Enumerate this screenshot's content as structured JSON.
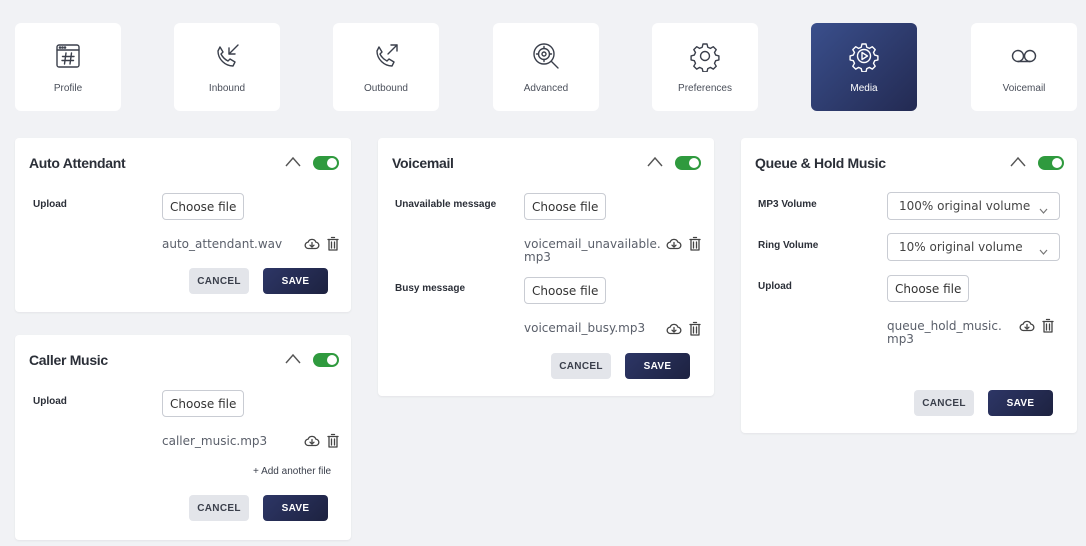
{
  "tabs": [
    {
      "label": "Profile",
      "icon": "hash-window-icon"
    },
    {
      "label": "Inbound",
      "icon": "phone-incoming-icon"
    },
    {
      "label": "Outbound",
      "icon": "phone-outgoing-icon"
    },
    {
      "label": "Advanced",
      "icon": "gear-search-icon"
    },
    {
      "label": "Preferences",
      "icon": "gear-icon"
    },
    {
      "label": "Media",
      "icon": "gear-play-icon"
    },
    {
      "label": "Voicemail",
      "icon": "voicemail-icon"
    }
  ],
  "active_tab": "Media",
  "colors": {
    "accent": "#2d3666",
    "toggle_on": "#2f9a3e"
  },
  "auto_attendant": {
    "title": "Auto Attendant",
    "upload_label": "Upload",
    "choose_file": "Choose file",
    "file_name": "auto_attendant.wav",
    "cancel": "CANCEL",
    "save": "SAVE"
  },
  "caller_music": {
    "title": "Caller Music",
    "upload_label": "Upload",
    "choose_file": "Choose file",
    "file_name": "caller_music.mp3",
    "add_another": "+ Add another file",
    "cancel": "CANCEL",
    "save": "SAVE"
  },
  "voicemail": {
    "title": "Voicemail",
    "unavailable_label": "Unavailable message",
    "choose_file_1": "Choose file",
    "unavailable_file_line1": "voicemail_unavailable.",
    "unavailable_file_line2": "mp3",
    "busy_label": "Busy message",
    "choose_file_2": "Choose file",
    "busy_file": "voicemail_busy.mp3",
    "cancel": "CANCEL",
    "save": "SAVE"
  },
  "queue_hold": {
    "title": "Queue & Hold Music",
    "mp3_volume_label": "MP3 Volume",
    "mp3_volume_value": "100% original volume",
    "ring_volume_label": "Ring Volume",
    "ring_volume_value": "10% original volume",
    "upload_label": "Upload",
    "choose_file": "Choose file",
    "file_line1": "queue_hold_music.",
    "file_line2": "mp3",
    "cancel": "CANCEL",
    "save": "SAVE"
  }
}
